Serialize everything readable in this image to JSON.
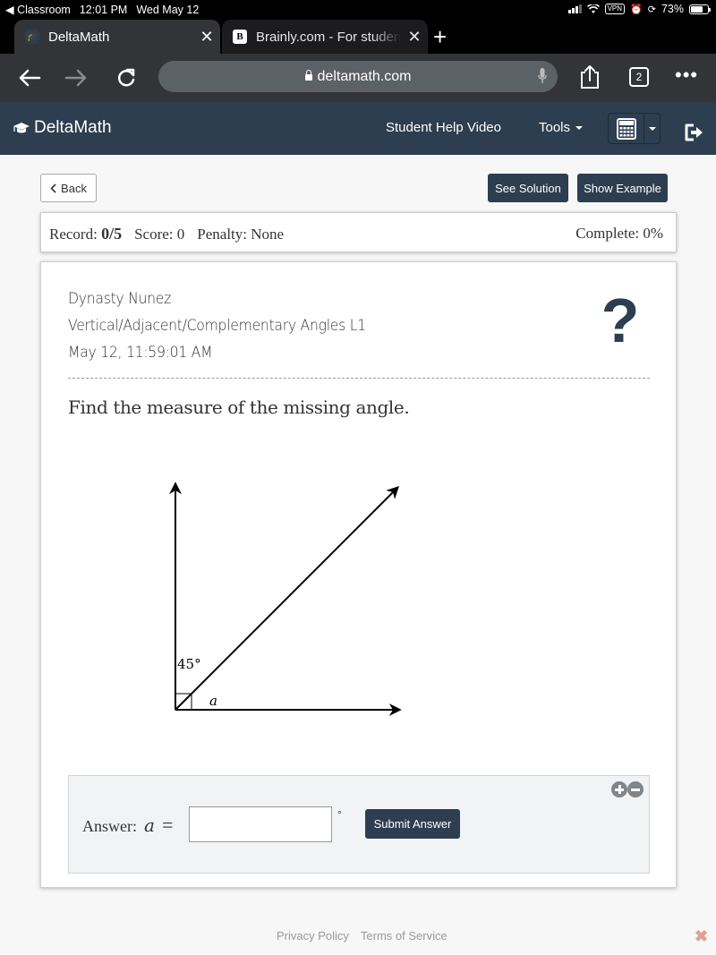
{
  "status_bar": {
    "back_app": "Classroom",
    "time": "12:01 PM",
    "date": "Wed May 12",
    "vpn": "VPN",
    "battery": "73%",
    "battery_level": 0.73
  },
  "browser": {
    "tabs": [
      {
        "title": "DeltaMath",
        "favicon": "graduation-cap-icon",
        "active": true
      },
      {
        "title": "Brainly.com - For students",
        "favicon": "B",
        "active": false
      }
    ],
    "url": "deltamath.com",
    "tab_count": "2"
  },
  "nav": {
    "logo": "DeltaMath",
    "help_video": "Student Help Video",
    "tools": "Tools"
  },
  "actions": {
    "back": "Back",
    "see_solution": "See Solution",
    "show_example": "Show Example"
  },
  "record": {
    "record_label": "Record:",
    "record_value": "0/5",
    "score": "Score: 0",
    "penalty": "Penalty: None",
    "complete": "Complete: 0%"
  },
  "problem": {
    "student_name": "Dynasty Nunez",
    "topic": "Vertical/Adjacent/Complementary Angles L1",
    "timestamp": "May 12, 11:59:01 AM",
    "prompt": "Find the measure of the missing angle.",
    "diagram": {
      "known_angle_label": "45°",
      "unknown_angle_label": "a",
      "right_angle_marker": true
    }
  },
  "answer": {
    "label": "Answer:",
    "variable": "a",
    "equals": "=",
    "value": "",
    "unit": "°",
    "submit": "Submit Answer"
  },
  "footer": {
    "privacy": "Privacy Policy",
    "terms": "Terms of Service"
  }
}
